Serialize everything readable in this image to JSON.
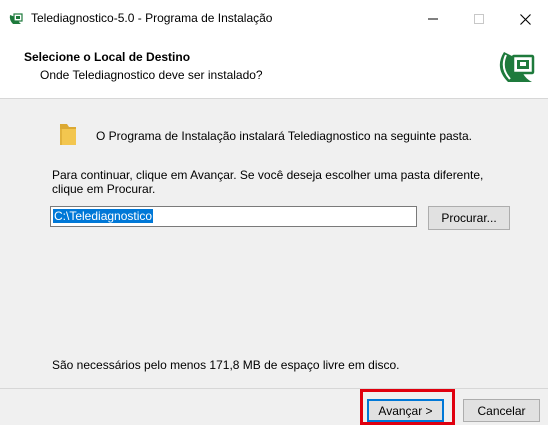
{
  "window": {
    "title": "Telediagnostico-5.0 - Programa de Instalação",
    "controls": {
      "minimize": "minimize-icon",
      "maximize": "maximize-icon",
      "close": "close-icon"
    }
  },
  "header": {
    "title": "Selecione o Local de Destino",
    "subtitle": "Onde Telediagnostico deve ser instalado?",
    "logo_icon": "computer-logo-icon"
  },
  "body": {
    "intro": "O Programa de Instalação instalará Telediagnostico na seguinte pasta.",
    "instructions": "Para continuar, clique em Avançar. Se você deseja escolher uma pasta diferente, clique em Procurar.",
    "path_value": "C:\\Telediagnostico",
    "browse_label": "Procurar...",
    "space_required": "São necessários pelo menos 171,8 MB de espaço livre em disco."
  },
  "footer": {
    "next_label": "Avançar >",
    "cancel_label": "Cancelar"
  },
  "colors": {
    "accent": "#0078d7",
    "highlight": "#e0000f",
    "logo_green": "#1e7a3c"
  }
}
